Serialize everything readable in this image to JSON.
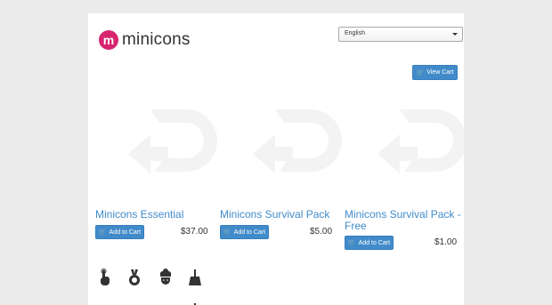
{
  "header": {
    "logo_badge": "m",
    "logo_text": "minicons",
    "language": "English"
  },
  "cart": {
    "view_cart_label": "View Cart"
  },
  "products": [
    {
      "title": "Minicons Essential",
      "add_label": "Add to Cart",
      "price": "$37.00"
    },
    {
      "title": "Minicons Survival Pack",
      "add_label": "Add to Cart",
      "price": "$5.00"
    },
    {
      "title_line1": "Minicons Survival Pack -",
      "title_line2": "Free",
      "add_label": "Add to Cart",
      "price": "$1.00"
    }
  ],
  "icons": [
    "hand-pointer-icon",
    "medal-icon",
    "chef-icon",
    "broom-icon",
    "arrow-icon",
    "hat-icon",
    "bottle-icon"
  ]
}
